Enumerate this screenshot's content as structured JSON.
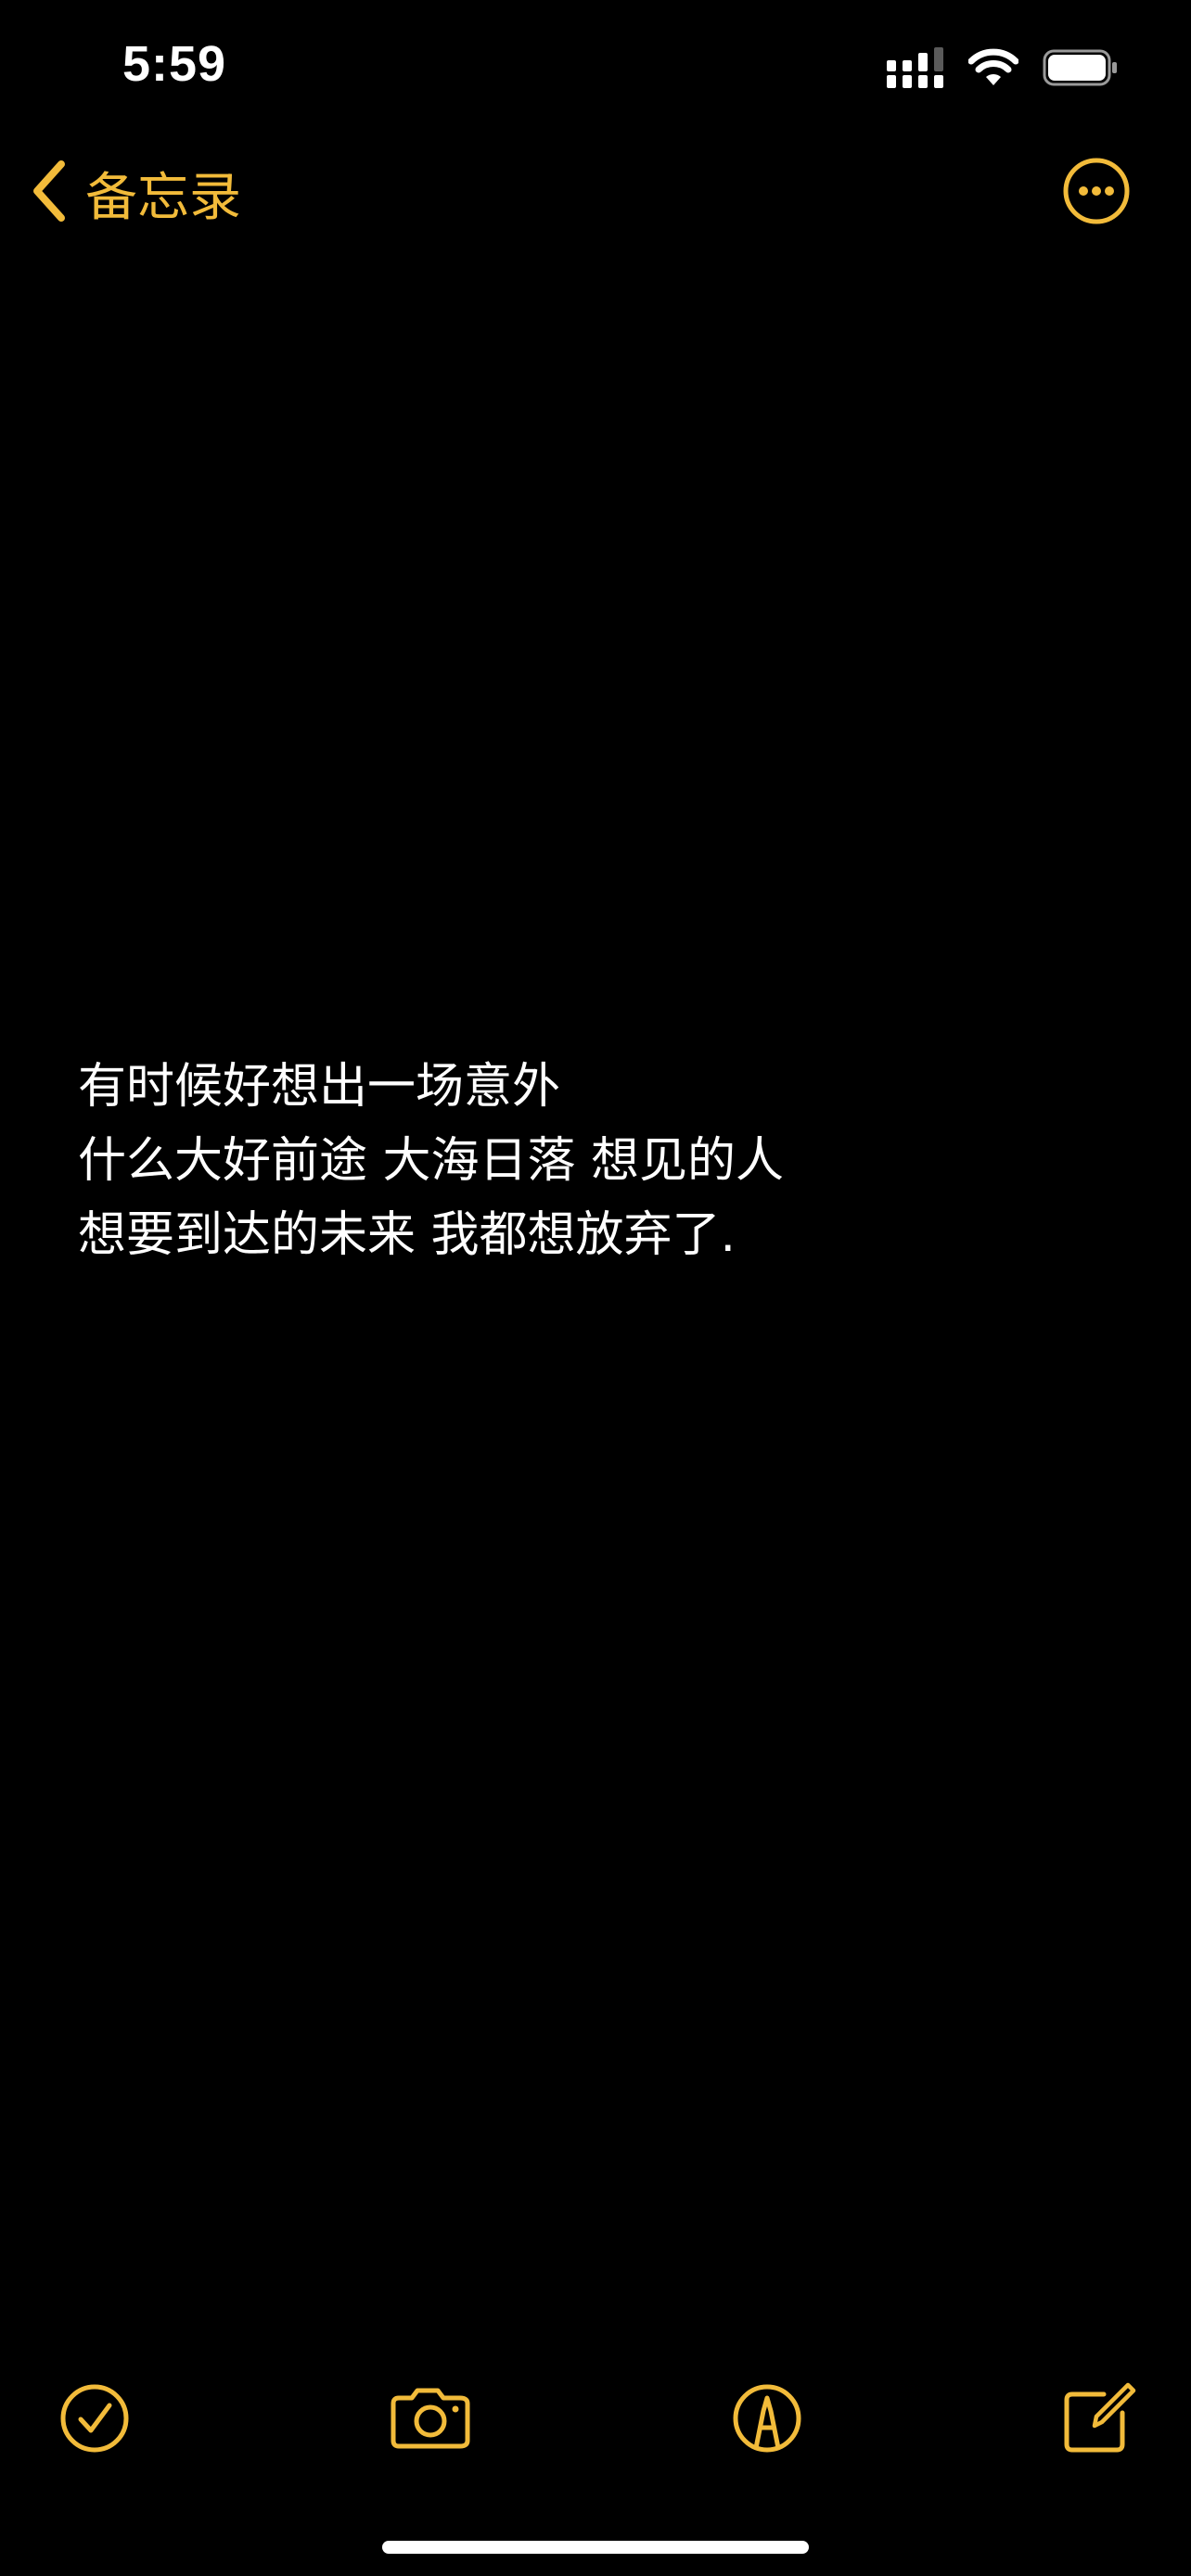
{
  "status_bar": {
    "time": "5:59",
    "signal_icon": "cellular-signal-icon",
    "wifi_icon": "wifi-icon",
    "battery_icon": "battery-icon",
    "battery_level": 1.0
  },
  "nav": {
    "back_label": "备忘录",
    "back_icon": "chevron-left-icon",
    "more_icon": "ellipsis-circle-icon"
  },
  "note": {
    "lines": [
      "有时候好想出一场意外",
      "什么大好前途 大海日落 想见的人",
      "想要到达的未来 我都想放弃了."
    ]
  },
  "toolbar": {
    "checklist_icon": "checklist-icon",
    "camera_icon": "camera-icon",
    "markup_icon": "markup-pen-icon",
    "compose_icon": "compose-icon"
  },
  "colors": {
    "accent": "#F2BB3A",
    "background": "#000000",
    "text": "#FFFFFF"
  }
}
